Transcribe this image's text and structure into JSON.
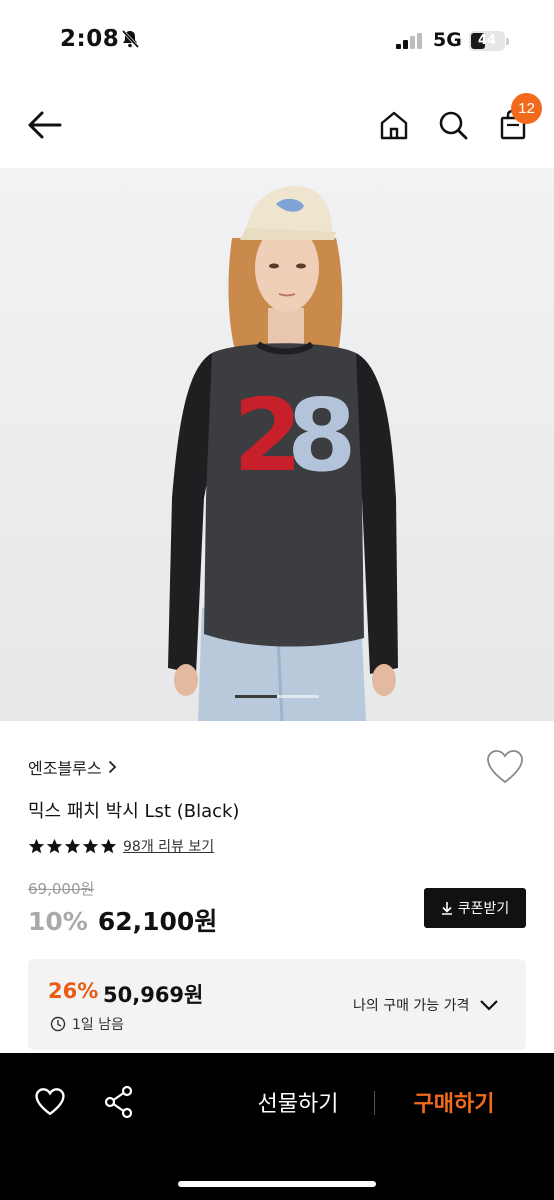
{
  "status": {
    "time": "2:08",
    "network": "5G",
    "battery_level": "44",
    "battery_fraction": 0.44
  },
  "nav": {
    "cart_count": "12"
  },
  "gallery": {
    "current_index": 1,
    "total": 2,
    "graphic_text": "28"
  },
  "product": {
    "brand": "엔조블루스",
    "name": "믹스 패치 박시 Lst (Black)",
    "rating_stars": 5,
    "review_link": "98개 리뷰 보기",
    "original_price": "69,000원",
    "discount_rate": "10%",
    "sale_price": "62,100원",
    "coupon_button": "쿠폰받기"
  },
  "my_price": {
    "discount_rate": "26%",
    "price": "50,969원",
    "remaining": "1일 남음",
    "label": "나의 구매 가능 가격"
  },
  "bottom": {
    "gift_label": "선물하기",
    "buy_label": "구매하기"
  },
  "colors": {
    "accent": "#f26a1b",
    "bottom_bar": "#000000"
  }
}
